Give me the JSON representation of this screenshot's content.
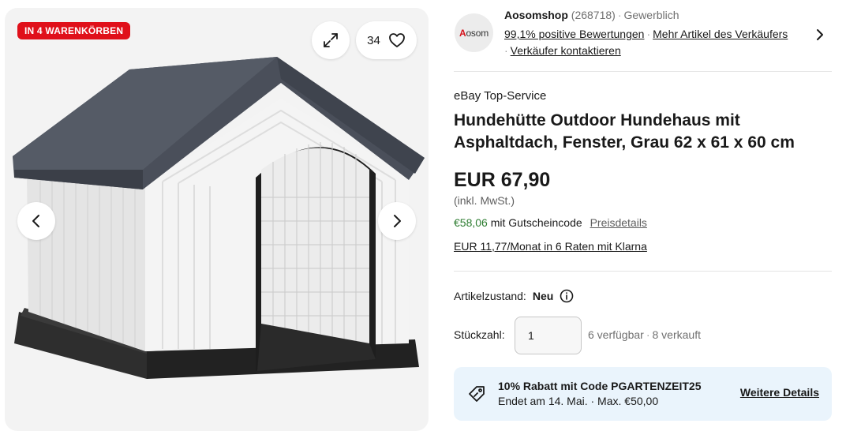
{
  "gallery": {
    "cart_badge": "IN 4 WARENKÖRBEN",
    "watch_count": "34",
    "icons": {
      "expand": "expand-icon",
      "heart": "heart-icon",
      "prev": "chevron-left-icon",
      "next": "chevron-right-icon"
    }
  },
  "seller": {
    "logo_prefix": "A",
    "logo_rest": "osom",
    "name": "Aosomshop",
    "score": "(268718)",
    "type": "Gewerblich",
    "positive": "99,1% positive Bewertungen",
    "more_items": "Mehr Artikel des Verkäufers",
    "contact": "Verkäufer kontaktieren"
  },
  "listing": {
    "service": "eBay Top-Service",
    "title": "Hundehütte Outdoor Hundehaus mit Asphaltdach, Fenster, Grau 62 x 61 x 60 cm",
    "price": "EUR 67,90",
    "vat_note": "(inkl. MwSt.)",
    "coupon_price": "€58,06",
    "coupon_text": "mit Gutscheincode",
    "price_details": "Preisdetails",
    "klarna": "EUR 11,77/Monat in 6 Raten mit Klarna"
  },
  "purchase": {
    "condition_label": "Artikelzustand:",
    "condition_value": "Neu",
    "qty_label": "Stückzahl:",
    "qty_value": "1",
    "available": "6 verfügbar",
    "sold": "8 verkauft"
  },
  "promo": {
    "title": "10% Rabatt mit Code PGARTENZEIT25",
    "subtitle": "Endet am 14. Mai. · Max. €50,00",
    "link": "Weitere Details"
  },
  "colors": {
    "badge_red": "#e0101a",
    "coupon_green": "#2e7d32",
    "promo_bg": "#eaf4fc",
    "roof": "#4a4f5a",
    "base": "#2b2b2b"
  }
}
